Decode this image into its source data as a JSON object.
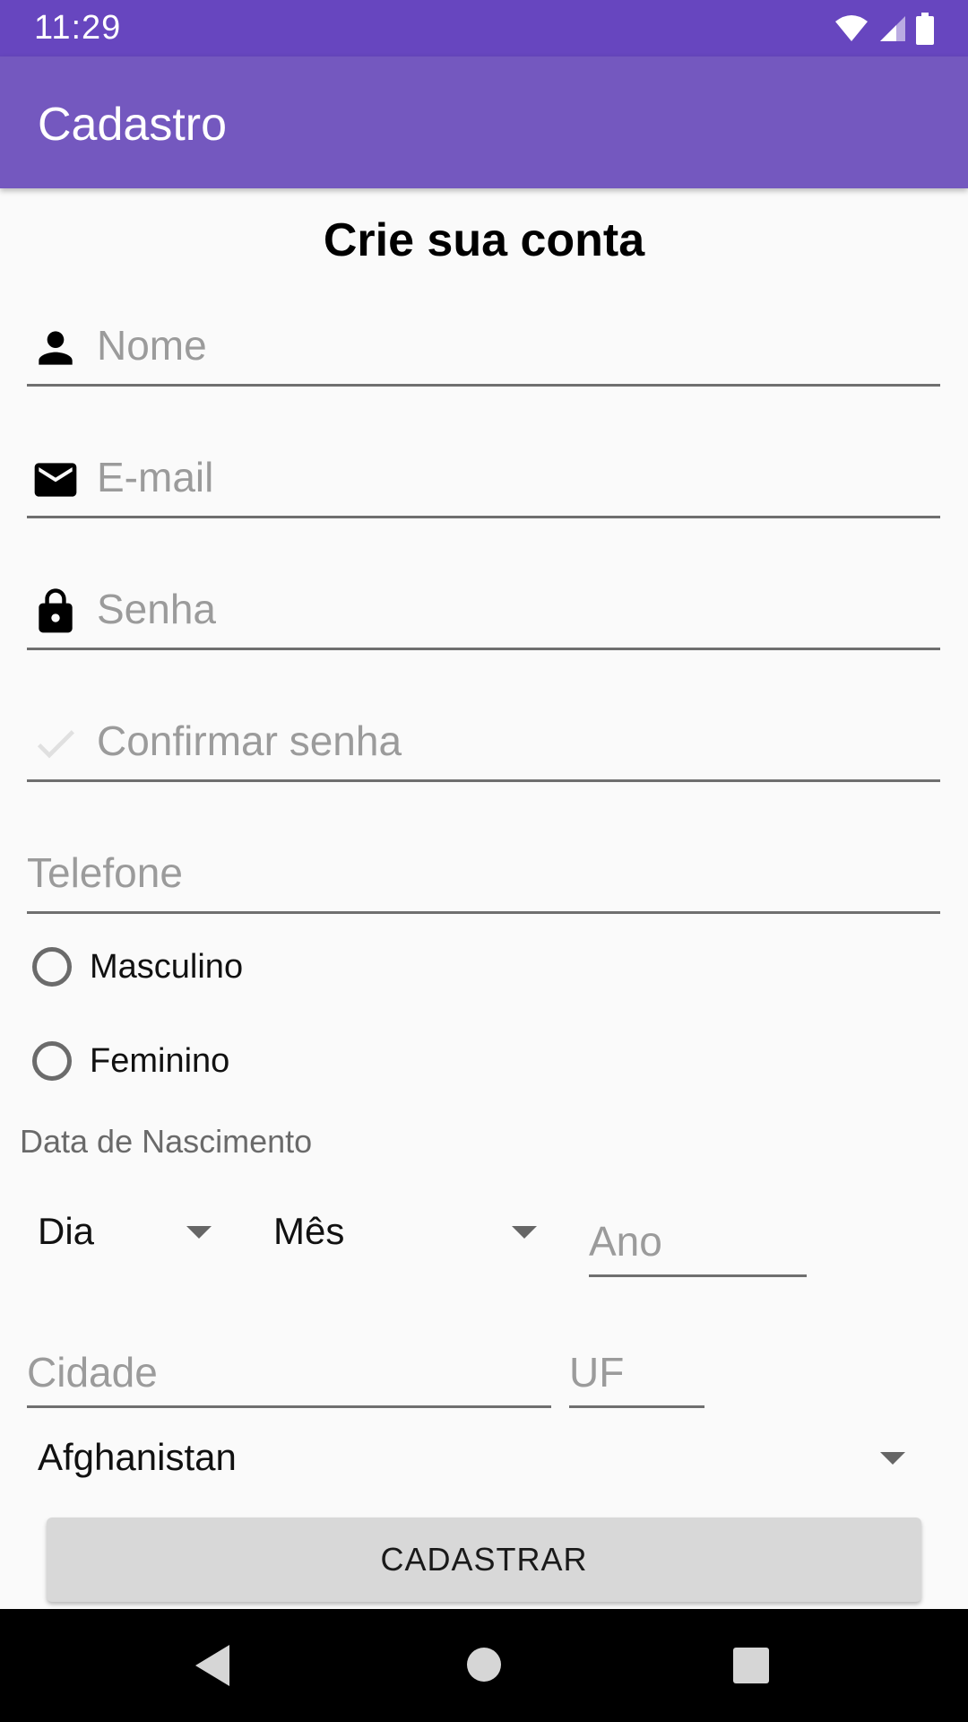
{
  "status_bar": {
    "time": "11:29",
    "icons": [
      "wifi-icon",
      "signal-icon",
      "battery-icon"
    ]
  },
  "app_bar": {
    "title": "Cadastro"
  },
  "form": {
    "heading": "Crie sua conta",
    "fields": {
      "nome": {
        "placeholder": "Nome",
        "value": "",
        "icon": "person-icon"
      },
      "email": {
        "placeholder": "E-mail",
        "value": "",
        "icon": "mail-icon"
      },
      "senha": {
        "placeholder": "Senha",
        "value": "",
        "icon": "lock-icon"
      },
      "confirmar": {
        "placeholder": "Confirmar senha",
        "value": "",
        "icon": "check-icon"
      },
      "telefone": {
        "placeholder": "Telefone",
        "value": ""
      },
      "ano": {
        "placeholder": "Ano",
        "value": ""
      },
      "cidade": {
        "placeholder": "Cidade",
        "value": ""
      },
      "uf": {
        "placeholder": "UF",
        "value": ""
      }
    },
    "gender_options": [
      "Masculino",
      "Feminino"
    ],
    "dob_label": "Data de Nascimento",
    "dob": {
      "dia": "Dia",
      "mes": "Mês"
    },
    "country": "Afghanistan",
    "submit_label": "CADASTRAR"
  },
  "colors": {
    "status_bar": "#6746BF",
    "app_bar": "#7458BF",
    "background": "#FAFAFA",
    "button": "#D8D8D8"
  }
}
